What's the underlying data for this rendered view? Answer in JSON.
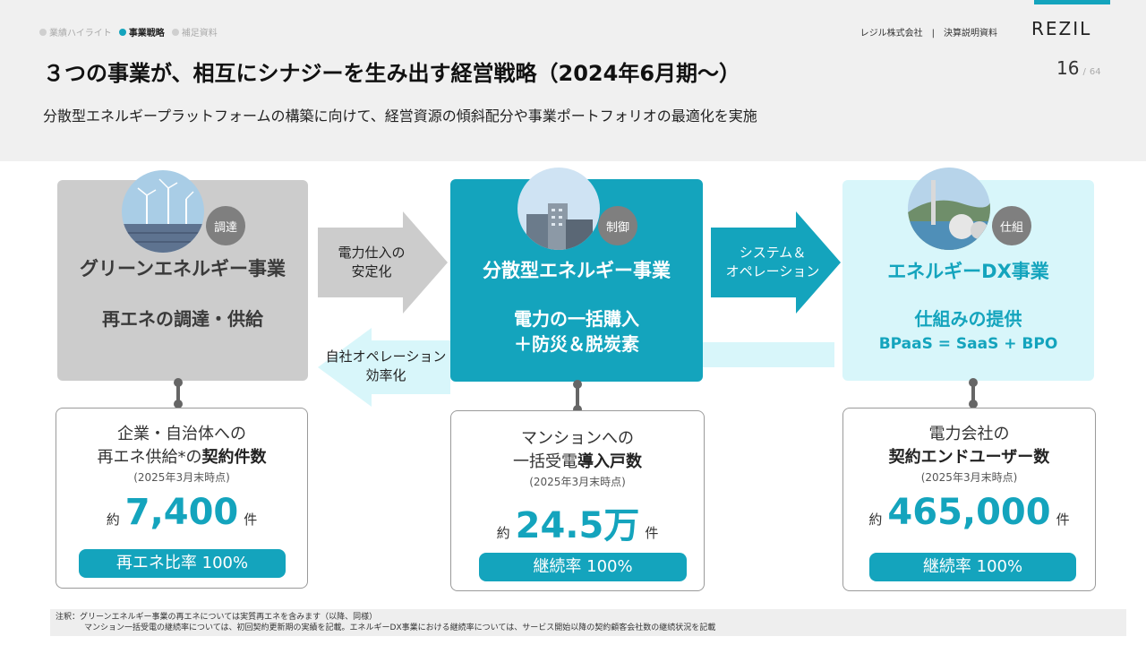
{
  "breadcrumbs": [
    {
      "label": "業績ハイライト",
      "active": false
    },
    {
      "label": "事業戦略",
      "active": true
    },
    {
      "label": "補足資料",
      "active": false
    }
  ],
  "company": "レジル株式会社　|　決算説明資料",
  "logo": "REZIL",
  "title": "３つの事業が、相互にシナジーを生み出す経営戦略（2024年6月期〜）",
  "page": {
    "current": "16",
    "total": "64"
  },
  "subtitle": "分散型エネルギープラットフォームの構築に向けて、経営資源の傾斜配分や事業ポートフォリオの最適化を実施",
  "businesses": [
    {
      "badge": "調達",
      "title": "グリーンエネルギー事業",
      "sub": [
        "再エネの調達・供給"
      ]
    },
    {
      "badge": "制御",
      "title": "分散型エネルギー事業",
      "sub": [
        "電力の一括購入",
        "＋防災＆脱炭素"
      ]
    },
    {
      "badge": "仕組",
      "title": "エネルギーDX事業",
      "sub": [
        "仕組みの提供"
      ],
      "sub2": "BPaaS = SaaS + BPO"
    }
  ],
  "arrows": {
    "a1": [
      "電力仕入の",
      "安定化"
    ],
    "a2": [
      "システム＆",
      "オペレーション"
    ],
    "a3": [
      "自社オペレーション",
      "効率化"
    ]
  },
  "kpis": [
    {
      "line1": "企業・自治体への",
      "line2_pre": "再エネ供給*の",
      "line2_bold": "契約件数",
      "note": "(2025年3月末時点)",
      "prefix": "約",
      "value": "7,400",
      "suffix": "件",
      "pill": "再エネ比率 100%"
    },
    {
      "line1": "マンションへの",
      "line2_pre": "一括受電",
      "line2_bold": "導入戸数",
      "note": "(2025年3月末時点)",
      "prefix": "約",
      "value": "24.5万",
      "suffix": "件",
      "pill": "継続率 100%"
    },
    {
      "line1": "電力会社の",
      "line2_pre": "",
      "line2_bold": "契約エンドユーザー数",
      "note": "(2025年3月末時点)",
      "prefix": "約",
      "value": "465,000",
      "suffix": "件",
      "pill": "継続率 100%"
    }
  ],
  "footnote": [
    "注釈：グリーンエネルギー事業の再エネについては実質再エネを含みます（以降、同様）",
    "マンション一括受電の継続率については、初回契約更新期の実績を記載。エネルギーDX事業における継続率については、サービス開始以降の契約顧客会社数の継続状況を記載"
  ],
  "colors": {
    "accent": "#14a4bd",
    "gray_card": "#cccccc",
    "light_card": "#d8f6fa",
    "badge": "#7f7f7f"
  }
}
